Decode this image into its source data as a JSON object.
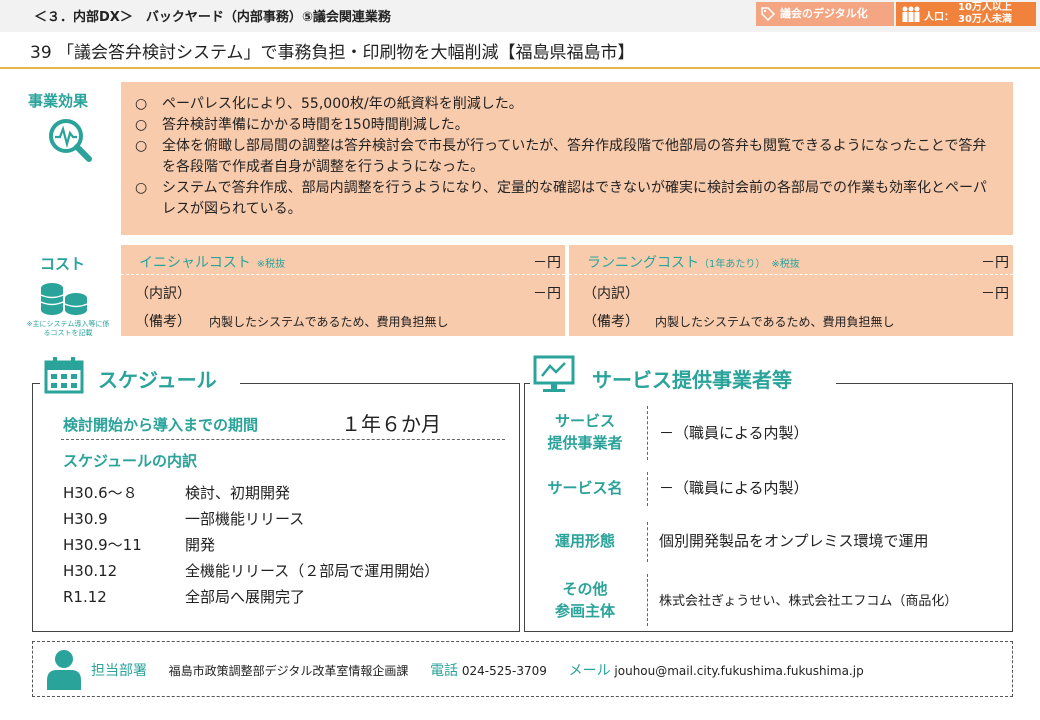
{
  "header": {
    "category": "＜３．内部DX＞　バックヤード（内部事務）⑤議会関連業務",
    "tag_digital": "議会のデジタル化",
    "tag_pop_prefix": "人口：",
    "tag_pop_line1": "10万人以上",
    "tag_pop_line2": "30万人未満",
    "title": "39 「議会答弁検討システム」で事務負担・印刷物を大幅削減【福島県福島市】"
  },
  "effects": {
    "label": "事業効果",
    "marker": "○",
    "items": [
      "ペーパレス化により、55,000枚/年の紙資料を削減した。",
      "答弁検討準備にかかる時間を150時間削減した。",
      "全体を俯瞰し部局間の調整は答弁検討会で市長が行っていたが、答弁作成段階で他部局の答弁も閲覧できるようになったことで答弁を各段階で作成者自身が調整を行うようになった。",
      "システムで答弁作成、部局内調整を行うようになり、定量的な確認はできないが確実に検討会前の各部局での作業も効率化とペーパレスが図られている。"
    ]
  },
  "cost": {
    "label": "コスト",
    "note": "※主にシステム導入等に係るコストを記載",
    "initial": {
      "label": "イニシャルコスト",
      "tax": "※税抜",
      "value": "－円",
      "breakdown_label": "（内訳）",
      "breakdown_value": "－円",
      "remarks_label": "（備考）",
      "remarks": "内製したシステムであるため、費用負担無し"
    },
    "running": {
      "label": "ランニングコスト",
      "label_small": "（1年あたり）",
      "tax": "※税抜",
      "value": "－円",
      "breakdown_label": "（内訳）",
      "breakdown_value": "－円",
      "remarks_label": "（備考）",
      "remarks": "内製したシステムであるため、費用負担無し"
    }
  },
  "schedule": {
    "title": "スケジュール",
    "period_label": "検討開始から導入までの期間",
    "period_value": "１年６か月",
    "breakdown_label": "スケジュールの内訳",
    "rows": [
      {
        "date": "H30.6～８",
        "desc": "検討、初期開発"
      },
      {
        "date": "H30.9",
        "desc": "一部機能リリース"
      },
      {
        "date": "H30.9～11",
        "desc": "開発"
      },
      {
        "date": "H30.12",
        "desc": "全機能リリース（２部局で運用開始）"
      },
      {
        "date": "R1.12",
        "desc": "全部局へ展開完了"
      }
    ]
  },
  "vendor": {
    "title": "サービス提供事業者等",
    "provider_label_1": "サービス",
    "provider_label_2": "提供事業者",
    "provider_value": "－（職員による内製）",
    "service_label": "サービス名",
    "service_value": "－（職員による内製）",
    "mode_label": "運用形態",
    "mode_value": "個別開発製品をオンプレミス環境で運用",
    "other_label_1": "その他",
    "other_label_2": "参画主体",
    "other_value": "株式会社ぎょうせい、株式会社エフコム（商品化）"
  },
  "contact": {
    "dept_label": "担当部署",
    "dept": "福島市政策調整部デジタル改革室情報企画課",
    "phone_label": "電話",
    "phone": "024-525-3709",
    "mail_label": "メール",
    "mail": "jouhou@mail.city.fukushima.fukushima.jp"
  },
  "colors": {
    "accent": "#2aa39a",
    "salmon": "#f8cbad",
    "orange": "#f0823c",
    "gold_rule": "#e8b64a"
  }
}
